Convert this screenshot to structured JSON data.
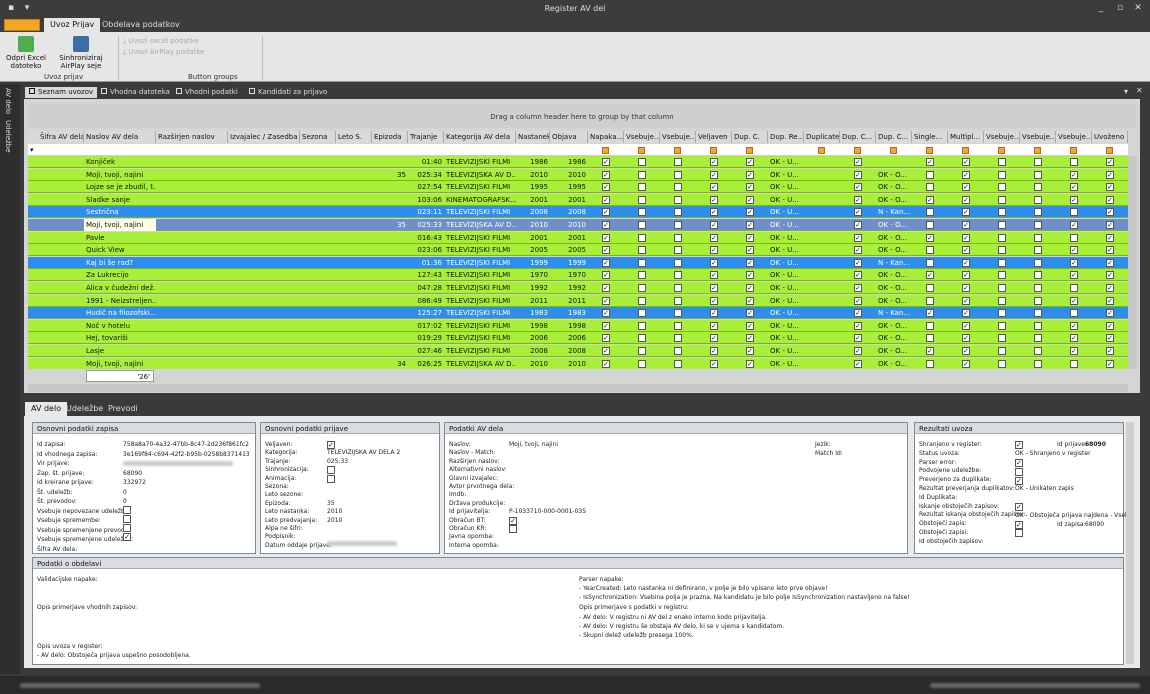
{
  "window": {
    "title": "Register AV del"
  },
  "menu": {
    "tabs": [
      "Uvoz Prijav",
      "Obdelava podatkov"
    ]
  },
  "ribbon": {
    "btn_excel": "Odpri Excel datoteko",
    "btn_sync": "Sinhroniziraj AirPlay seje",
    "small1": "Uvozi excel podatke",
    "small2": "Uvozi AirPlay podatke",
    "group1": "Uvoz prijav",
    "group2": "Button groups"
  },
  "side": {
    "tab1": "AV delo",
    "tab2": "Udeležbe"
  },
  "doc_tabs": [
    "Seznam uvozov",
    "Vhodna datoteka",
    "Vhodni podatki",
    "Kandidati za prijavo"
  ],
  "grid": {
    "group_hint": "Drag a column header here to group by that column",
    "columns": [
      "Šifra AV dela",
      "Naslov AV dela",
      "Razširjen naslov",
      "Izvajalec / Zasedba",
      "Sezona",
      "Leto S.",
      "Epizoda",
      "Trajanje",
      "Kategorija AV dela",
      "Nastanek",
      "Objava",
      "Napaka...",
      "Vsebuje...",
      "Vsebuje...",
      "Veljaven",
      "Dup. C.",
      "Dup. Re...",
      "Duplicate",
      "Dup. C...",
      "Dup. C...",
      "Single...",
      "Multipl...",
      "Vsebuje...",
      "Vsebuje...",
      "Vsebuje...",
      "Uvoženo"
    ],
    "edit_value": "'26'",
    "rows": [
      {
        "title": "Konjiček",
        "ep": "",
        "dur": "01:40",
        "cat": "TELEVIZIJSKI FILMI",
        "n": "1986",
        "o": "1986",
        "dup": "OK - U...",
        "dc": "",
        "color": "#a8ef3a"
      },
      {
        "title": "Moji, tvoji, najini",
        "ep": "35",
        "dur": "025:34",
        "cat": "TELEVIZIJSKA AV D...",
        "n": "2010",
        "o": "2010",
        "dup": "OK - U...",
        "dc": "OK - O...",
        "color": "#a8ef3a"
      },
      {
        "title": "Lojze se je zbudil, t...",
        "ep": "",
        "dur": "027:54",
        "cat": "TELEVIZIJSKI FILMI",
        "n": "1995",
        "o": "1995",
        "dup": "OK - U...",
        "dc": "OK - O...",
        "color": "#a8ef3a"
      },
      {
        "title": "Sladke sanje",
        "ep": "",
        "dur": "103:06",
        "cat": "KINEMATOGRAFSK...",
        "n": "2001",
        "o": "2001",
        "dup": "OK - U...",
        "dc": "OK - O...",
        "color": "#a8ef3a"
      },
      {
        "title": "Sestrična",
        "ep": "",
        "dur": "023:11",
        "cat": "TELEVIZIJSKI FILMI",
        "n": "2008",
        "o": "2008",
        "dup": "OK - U...",
        "dc": "N - Kan...",
        "color": "#2e8ef0"
      },
      {
        "title": "Moji, tvoji, najini",
        "ep": "35",
        "dur": "025:33",
        "cat": "TELEVIZIJSKA AV D...",
        "n": "2010",
        "o": "2010",
        "dup": "OK - U...",
        "dc": "OK - O...",
        "color": "#6f8fc8"
      },
      {
        "title": "Pavle",
        "ep": "",
        "dur": "016:43",
        "cat": "TELEVIZIJSKI FILMI",
        "n": "2001",
        "o": "2001",
        "dup": "OK - U...",
        "dc": "OK - O...",
        "color": "#a8ef3a"
      },
      {
        "title": "Quick View",
        "ep": "",
        "dur": "023:06",
        "cat": "TELEVIZIJSKI FILMI",
        "n": "2005",
        "o": "2005",
        "dup": "OK - U...",
        "dc": "OK - O...",
        "color": "#a8ef3a"
      },
      {
        "title": "Kaj bi še rad?",
        "ep": "",
        "dur": "01:36",
        "cat": "TELEVIZIJSKI FILMI",
        "n": "1999",
        "o": "1999",
        "dup": "OK - U...",
        "dc": "N - Kan...",
        "color": "#2e8ef0"
      },
      {
        "title": "Za Lukrecijo",
        "ep": "",
        "dur": "127:43",
        "cat": "TELEVIZIJSKI FILMI",
        "n": "1970",
        "o": "1970",
        "dup": "OK - U...",
        "dc": "OK - O...",
        "color": "#a8ef3a"
      },
      {
        "title": "Alica v čudežni dež...",
        "ep": "",
        "dur": "047:28",
        "cat": "TELEVIZIJSKI FILMI",
        "n": "1992",
        "o": "1992",
        "dup": "OK - U...",
        "dc": "OK - O...",
        "color": "#a8ef3a"
      },
      {
        "title": "1991 - Neizstreljen...",
        "ep": "",
        "dur": "086:49",
        "cat": "TELEVIZIJSKI FILMI",
        "n": "2011",
        "o": "2011",
        "dup": "OK - U...",
        "dc": "OK - O...",
        "color": "#a8ef3a"
      },
      {
        "title": "Hudič na filozofski...",
        "ep": "",
        "dur": "125:27",
        "cat": "TELEVIZIJSKI FILMI",
        "n": "1983",
        "o": "1983",
        "dup": "OK - U...",
        "dc": "N - Kan...",
        "color": "#2e8ef0"
      },
      {
        "title": "Noč v hotelu",
        "ep": "",
        "dur": "017:02",
        "cat": "TELEVIZIJSKI FILMI",
        "n": "1998",
        "o": "1998",
        "dup": "OK - U...",
        "dc": "OK - O...",
        "color": "#a8ef3a"
      },
      {
        "title": "Hej, tovariši",
        "ep": "",
        "dur": "019:29",
        "cat": "TELEVIZIJSKI FILMI",
        "n": "2006",
        "o": "2006",
        "dup": "OK - U...",
        "dc": "OK - O...",
        "color": "#a8ef3a"
      },
      {
        "title": "Lasje",
        "ep": "",
        "dur": "027:46",
        "cat": "TELEVIZIJSKI FILMI",
        "n": "2008",
        "o": "2008",
        "dup": "OK - U...",
        "dc": "OK - O...",
        "color": "#a8ef3a"
      },
      {
        "title": "Moji, tvoji, najini",
        "ep": "34",
        "dur": "026:25",
        "cat": "TELEVIZIJSKA AV D...",
        "n": "2010",
        "o": "2010",
        "dup": "OK - U...",
        "dc": "OK - O...",
        "color": "#a8ef3a"
      }
    ]
  },
  "bottom_tabs": [
    "AV delo",
    "Udeležbe",
    "Prevodi"
  ],
  "osnovni_zapis": {
    "title": "Osnovni podatki zapisa",
    "labels": [
      "Id zapisa:",
      "Id vhodnega zapisa:",
      "Vir prijave:",
      "Zap. št. prijave:",
      "Id kreirane prijave:",
      "Št. udeležb:",
      "Št. prevodov:",
      "Vsebuje nepovezane udeležbe:",
      "Vsebuje spremembe:",
      "Vsebuje spremenjene prevode:",
      "Vsebuje spremenjene udeležbe:",
      "Šifra AV dela:"
    ],
    "values": [
      "758a8a70-4a32-47bb-8c47-2d236f861fc2",
      "3e169f84-c694-42f2-b95b-0258b8371413",
      "",
      "68090",
      "332972",
      "0",
      "0"
    ]
  },
  "osnovni_prijave": {
    "title": "Osnovni podatki prijave",
    "labels": [
      "Veljaven:",
      "Kategorija:",
      "Trajanje:",
      "Sinhronizacija:",
      "Animacija:",
      "Sezona:",
      "Leto sezone:",
      "Epizoda:",
      "Leto nastanka:",
      "Leto predvajanja:",
      "Alpa ne šifri:",
      "Podpisnik:",
      "Datum oddaje prijave:"
    ],
    "values": [
      "",
      "TELEVIZIJSKA AV DELA 2",
      "025:33",
      "",
      "",
      "",
      "",
      "35",
      "2010",
      "2010"
    ]
  },
  "podatki_av": {
    "title": "Podatki AV dela",
    "labels": [
      "Naslov:",
      "Naslov - Match:",
      "Razširjen naslov:",
      "Alternativni naslov:",
      "Glavni izvajalec:",
      "Avtor prvotnega dela:",
      "Imdb:",
      "Država produkcije:",
      "Id prijavitelja:",
      "Obračun BT:",
      "Obračun KR:",
      "Javna opomba:",
      "Interna opomba:"
    ],
    "values": [
      "Moji, tvoji, najini",
      "",
      "",
      "",
      "",
      "",
      "",
      "",
      "P-1033710-000-0001-035"
    ],
    "right_labels": [
      "Jezik:",
      "Match Id:"
    ]
  },
  "rezultati": {
    "title": "Rezultati uvoza",
    "labels": [
      "Shranjeno v register:",
      "Status uvoza:",
      "Parser error:",
      "Podvojene udeležbe:",
      "Preverjeno za duplikate:",
      "Rezultat preverjanja duplikatov:",
      "Id Duplikata:",
      "Iskanje obstoječih zapisov:",
      "Rezultat iskanja obstoječih zapisov:",
      "Obstoječi zapis:",
      "Obstoječi zapisi:",
      "Id obstoječih zapisov:"
    ],
    "id_prijave_label": "Id prijave:",
    "id_prijave": "68090",
    "status": "OK - Shranjeno v register",
    "dup_result": "OK - Unikaten zapis",
    "search_result": "OK - Obstoječa prijava najdena - Vsebi",
    "id_zapisa_label": "Id zapisa:",
    "id_zapisa": "68090"
  },
  "obdelava": {
    "title": "Podatki o obdelavi",
    "val_label": "Validacijske napake:",
    "opis_vhod": "Opis primerjave vhodnih zapisov:",
    "opis_uvoz": "Opis uvoza v register:",
    "opis_uvoz_val": "- AV delo: Obstoječa prijava uspešno posodobljena.",
    "parser_label": "Parser napake:",
    "parser_lines": [
      "- YearCreated: Leto nastanka ni definirano, v polje je bilo vpisano leto prve objave!",
      "- IsSynchronization: Vsebina polja je prazna. Na kandidatu je bilo polje IsSynchronization nastavljeno na false!"
    ],
    "opis_reg_label": "Opis primerjave s podatki v registru:",
    "opis_reg_lines": [
      "- AV delo: V registru ni AV del z enako interno kodo prijavitelja.",
      "- AV delo: V registru še obstaja AV delo, ki se v ujema s kandidatom.",
      "- Skupni delež udeležb presega 100%."
    ]
  }
}
